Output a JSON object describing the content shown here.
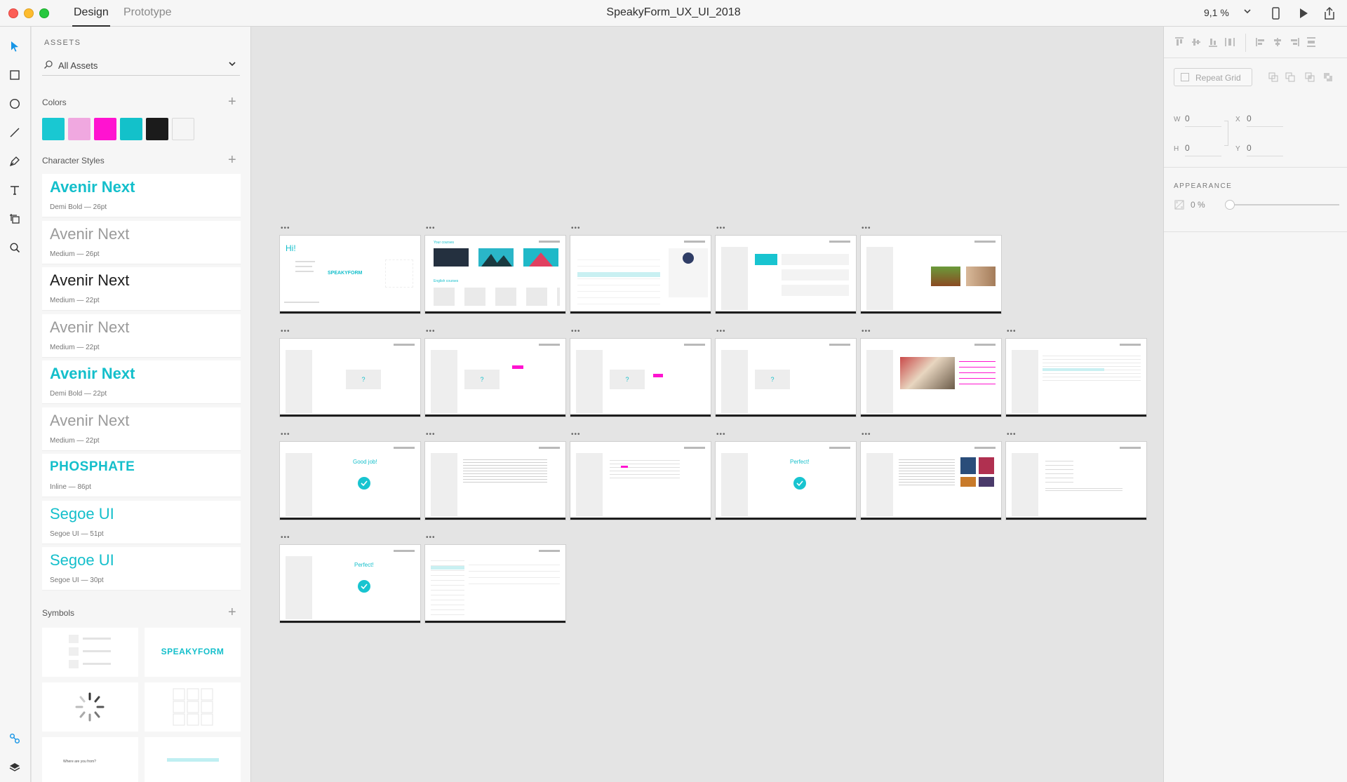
{
  "window": {
    "title": "SpeakyForm_UX_UI_2018",
    "modes": [
      {
        "label": "Design",
        "active": true
      },
      {
        "label": "Prototype",
        "active": false
      }
    ],
    "zoom": "9,1 %"
  },
  "tools": [
    "select-tool",
    "rectangle-tool",
    "ellipse-tool",
    "line-tool",
    "pen-tool",
    "text-tool",
    "artboard-tool",
    "zoom-tool"
  ],
  "assets": {
    "title": "ASSETS",
    "filter": "All Assets",
    "colors_label": "Colors",
    "colors": [
      "#19c8d2",
      "#f0a8e0",
      "#ff13d0",
      "#13c1ca",
      "#1b1b1b",
      "#f5f5f5"
    ],
    "character_styles_label": "Character Styles",
    "character_styles": [
      {
        "name": "Avenir Next",
        "sub": "Demi Bold — 26pt",
        "color": "#14bfcb",
        "weight": "600"
      },
      {
        "name": "Avenir Next",
        "sub": "Medium — 26pt",
        "color": "#9b9b9b",
        "weight": "400"
      },
      {
        "name": "Avenir Next",
        "sub": "Medium — 22pt",
        "color": "#1e1e1e",
        "weight": "400"
      },
      {
        "name": "Avenir Next",
        "sub": "Medium — 22pt",
        "color": "#9b9b9b",
        "weight": "400"
      },
      {
        "name": "Avenir Next",
        "sub": "Demi Bold — 22pt",
        "color": "#14bfcb",
        "weight": "600"
      },
      {
        "name": "Avenir Next",
        "sub": "Medium — 22pt",
        "color": "#9b9b9b",
        "weight": "400"
      },
      {
        "name": "PHOSPHATE",
        "sub": "Inline — 86pt",
        "color": "#14bfcb",
        "weight": "700"
      },
      {
        "name": "Segoe UI",
        "sub": "Segoe UI — 51pt",
        "color": "#14bfcb",
        "weight": "400"
      },
      {
        "name": "Segoe UI",
        "sub": "Segoe UI — 30pt",
        "color": "#14bfcb",
        "weight": "400"
      }
    ],
    "symbols_label": "Symbols",
    "symbols": [
      {
        "type": "list"
      },
      {
        "type": "logo",
        "text": "SPEAKYFORM"
      },
      {
        "type": "spinner"
      },
      {
        "type": "grid"
      },
      {
        "type": "question",
        "text": "Where are you from?"
      },
      {
        "type": "bar"
      }
    ]
  },
  "canvas": {
    "artboard_text": {
      "hi": "Hi!",
      "logo": "SPEAKYFORM",
      "your_courses": "Your courses",
      "english_courses": "English courses",
      "good_job": "Good job!",
      "perfect": "Perfect!",
      "question": "?"
    },
    "rows": [
      [
        "welcome",
        "courses",
        "lessons",
        "words",
        "photos"
      ],
      [
        "quiz",
        "quiz-pink",
        "quiz-pink",
        "quiz",
        "photo-quiz",
        "list-check"
      ],
      [
        "good-job",
        "article",
        "article-drag",
        "perfect",
        "article-images",
        "checklist"
      ],
      [
        "perfect",
        "table"
      ]
    ]
  },
  "properties": {
    "repeat_grid": "Repeat Grid",
    "w_label": "W",
    "w": "0",
    "h_label": "H",
    "h": "0",
    "x_label": "X",
    "x": "0",
    "y_label": "Y",
    "y": "0",
    "appearance": "APPEARANCE",
    "opacity": "0 %"
  }
}
